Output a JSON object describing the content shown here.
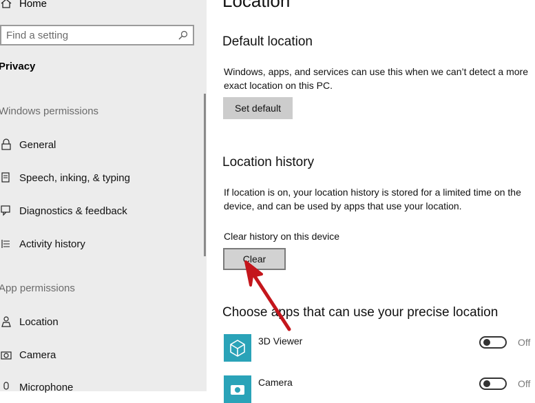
{
  "sidebar": {
    "home_label": "Home",
    "search_placeholder": "Find a setting",
    "category": "Privacy",
    "windows_permissions_header": "Windows permissions",
    "windows_items": [
      {
        "label": "General",
        "icon": "lock-icon"
      },
      {
        "label": "Speech, inking, & typing",
        "icon": "speech-icon"
      },
      {
        "label": "Diagnostics & feedback",
        "icon": "feedback-icon"
      },
      {
        "label": "Activity history",
        "icon": "activity-icon"
      }
    ],
    "app_permissions_header": "App permissions",
    "app_items": [
      {
        "label": "Location",
        "icon": "location-icon"
      },
      {
        "label": "Camera",
        "icon": "camera-icon"
      },
      {
        "label": "Microphone",
        "icon": "microphone-icon"
      }
    ]
  },
  "main": {
    "title": "Location",
    "default_location": {
      "heading": "Default location",
      "description": "Windows, apps, and services can use this when we can’t detect a more exact location on this PC.",
      "button": "Set default"
    },
    "location_history": {
      "heading": "Location history",
      "description": "If location is on, your location history is stored for a limited time on the device, and can be used by apps that use your location.",
      "clear_label": "Clear history on this device",
      "button": "Clear"
    },
    "apps_section": {
      "heading": "Choose apps that can use your precise location",
      "apps": [
        {
          "name": "3D Viewer",
          "state": "Off",
          "icon": "3d-viewer-icon"
        },
        {
          "name": "Camera",
          "state": "Off",
          "icon": "camera-app-icon"
        }
      ]
    }
  },
  "colors": {
    "sidebar_bg": "#ececec",
    "accent_tile": "#2aa3b8",
    "annotation_arrow": "#c4161c"
  }
}
